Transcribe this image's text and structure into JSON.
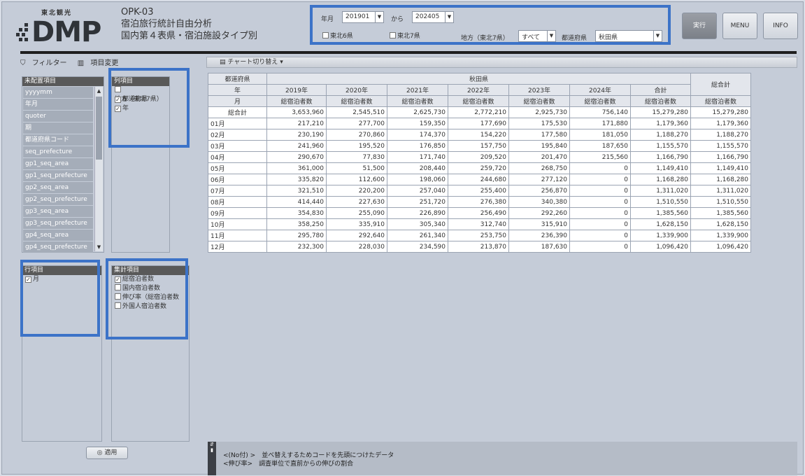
{
  "logo": {
    "small": "東北観光",
    "big": "DMP"
  },
  "header": {
    "code": "OPK-03",
    "title": "宿泊旅行統計自由分析",
    "subtitle": "国内第４表県・宿泊施設タイプ別"
  },
  "filters": {
    "ym_label": "年月",
    "from_value": "201901",
    "kara_label": "から",
    "to_value": "202405",
    "tohoku6_label": "東北6県",
    "tohoku7_label": "東北7県",
    "region_label": "地方（東北7県）",
    "region_value": "すべて",
    "pref_label": "都道府県",
    "pref_value": "秋田県"
  },
  "buttons": {
    "run": "実行",
    "menu": "MENU",
    "info": "INFO",
    "apply": "適用"
  },
  "left_tabs": {
    "filter": "フィルター",
    "items": "項目変更"
  },
  "unassigned": {
    "header": "未配置項目",
    "items": [
      "yyyymm",
      "年月",
      "quoter",
      "期",
      "都道府県コード",
      "seq_prefecture",
      "gp1_seq_area",
      "gp1_seq_prefecture",
      "gp2_seq_area",
      "gp2_seq_prefecture",
      "gp3_seq_area",
      "gp3_seq_prefecture",
      "gp4_seq_area",
      "gp4_seq_prefecture"
    ]
  },
  "col_items": {
    "header": "列項目",
    "items": [
      {
        "label": "地方（東北7県）",
        "checked": false
      },
      {
        "label": "都道府県",
        "checked": true
      },
      {
        "label": "年",
        "checked": true
      }
    ]
  },
  "row_items": {
    "header": "行項目",
    "items": [
      {
        "label": "月",
        "checked": true
      }
    ]
  },
  "agg_items": {
    "header": "集計項目",
    "items": [
      {
        "label": "総宿泊者数",
        "checked": true
      },
      {
        "label": "国内宿泊者数",
        "checked": false
      },
      {
        "label": "伸び率（総宿泊者数",
        "checked": false
      },
      {
        "label": "外国人宿泊者数",
        "checked": false
      }
    ]
  },
  "chart_toggle": "チャート切り替え",
  "table": {
    "h_pref": "都道府県",
    "pref_name": "秋田県",
    "grand_total": "総合計",
    "h_year": "年",
    "h_month": "月",
    "years": [
      "2019年",
      "2020年",
      "2021年",
      "2022年",
      "2023年",
      "2024年",
      "合計"
    ],
    "measure": "総宿泊者数",
    "rows": [
      {
        "label": "総合計",
        "values": [
          "3,653,960",
          "2,545,510",
          "2,625,730",
          "2,772,210",
          "2,925,730",
          "756,140",
          "15,279,280",
          "15,279,280"
        ]
      },
      {
        "label": "01月",
        "values": [
          "217,210",
          "277,700",
          "159,350",
          "177,690",
          "175,530",
          "171,880",
          "1,179,360",
          "1,179,360"
        ]
      },
      {
        "label": "02月",
        "values": [
          "230,190",
          "270,860",
          "174,370",
          "154,220",
          "177,580",
          "181,050",
          "1,188,270",
          "1,188,270"
        ]
      },
      {
        "label": "03月",
        "values": [
          "241,960",
          "195,520",
          "176,850",
          "157,750",
          "195,840",
          "187,650",
          "1,155,570",
          "1,155,570"
        ]
      },
      {
        "label": "04月",
        "values": [
          "290,670",
          "77,830",
          "171,740",
          "209,520",
          "201,470",
          "215,560",
          "1,166,790",
          "1,166,790"
        ]
      },
      {
        "label": "05月",
        "values": [
          "361,000",
          "51,500",
          "208,440",
          "259,720",
          "268,750",
          "0",
          "1,149,410",
          "1,149,410"
        ]
      },
      {
        "label": "06月",
        "values": [
          "335,820",
          "112,600",
          "198,060",
          "244,680",
          "277,120",
          "0",
          "1,168,280",
          "1,168,280"
        ]
      },
      {
        "label": "07月",
        "values": [
          "321,510",
          "220,200",
          "257,040",
          "255,400",
          "256,870",
          "0",
          "1,311,020",
          "1,311,020"
        ]
      },
      {
        "label": "08月",
        "values": [
          "414,440",
          "227,630",
          "251,720",
          "276,380",
          "340,380",
          "0",
          "1,510,550",
          "1,510,550"
        ]
      },
      {
        "label": "09月",
        "values": [
          "354,830",
          "255,090",
          "226,890",
          "256,490",
          "292,260",
          "0",
          "1,385,560",
          "1,385,560"
        ]
      },
      {
        "label": "10月",
        "values": [
          "358,250",
          "335,910",
          "305,340",
          "312,740",
          "315,910",
          "0",
          "1,628,150",
          "1,628,150"
        ]
      },
      {
        "label": "11月",
        "values": [
          "295,780",
          "292,640",
          "261,340",
          "253,750",
          "236,390",
          "0",
          "1,339,900",
          "1,339,900"
        ]
      },
      {
        "label": "12月",
        "values": [
          "232,300",
          "228,030",
          "234,590",
          "213,870",
          "187,630",
          "0",
          "1,096,420",
          "1,096,420"
        ]
      }
    ]
  },
  "footer": {
    "line1": "<(No付) >　並べ替えするためコードを先頭につけたデータ",
    "line2": "<伸び率>　調査単位で直前からの伸びの割合"
  },
  "colors": {
    "highlight": "#3c73c8",
    "header_dark": "#595959"
  }
}
